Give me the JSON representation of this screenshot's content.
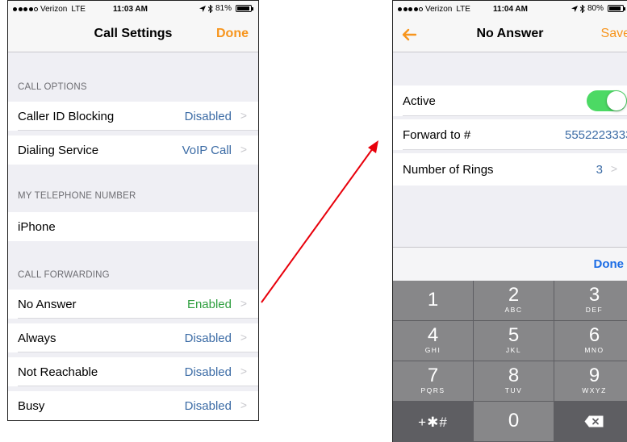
{
  "left_screen": {
    "status_bar": {
      "carrier": "Verizon",
      "network": "LTE",
      "time": "11:03 AM",
      "battery": "81%"
    },
    "nav": {
      "title": "Call Settings",
      "done_label": "Done"
    },
    "sections": [
      {
        "header": "CALL OPTIONS",
        "rows": [
          {
            "label": "Caller ID Blocking",
            "value": "Disabled"
          },
          {
            "label": "Dialing Service",
            "value": "VoIP Call"
          }
        ]
      },
      {
        "header": "MY TELEPHONE NUMBER",
        "rows": [
          {
            "label": "iPhone"
          }
        ]
      },
      {
        "header": "CALL FORWARDING",
        "rows": [
          {
            "label": "No Answer",
            "value": "Enabled"
          },
          {
            "label": "Always",
            "value": "Disabled"
          },
          {
            "label": "Not Reachable",
            "value": "Disabled"
          },
          {
            "label": "Busy",
            "value": "Disabled"
          }
        ]
      }
    ]
  },
  "right_screen": {
    "status_bar": {
      "carrier": "Verizon",
      "network": "LTE",
      "time": "11:04 AM",
      "battery": "80%"
    },
    "nav": {
      "title": "No Answer",
      "save_label": "Save"
    },
    "rows": {
      "active": {
        "label": "Active",
        "toggle_on": true
      },
      "forward_to": {
        "label": "Forward to #",
        "value": "5552223333"
      },
      "rings": {
        "label": "Number of Rings",
        "value": "3"
      }
    },
    "keyboard": {
      "done_label": "Done",
      "keys": [
        {
          "num": "1",
          "letters": ""
        },
        {
          "num": "2",
          "letters": "ABC"
        },
        {
          "num": "3",
          "letters": "DEF"
        },
        {
          "num": "4",
          "letters": "GHI"
        },
        {
          "num": "5",
          "letters": "JKL"
        },
        {
          "num": "6",
          "letters": "MNO"
        },
        {
          "num": "7",
          "letters": "PQRS"
        },
        {
          "num": "8",
          "letters": "TUV"
        },
        {
          "num": "9",
          "letters": "WXYZ"
        },
        {
          "symbols": "+✱#"
        },
        {
          "num": "0"
        },
        {
          "icon": "backspace-icon"
        }
      ]
    }
  },
  "colors": {
    "accent_orange": "#f7951d",
    "value_blue": "#3b6ba5",
    "enabled_green": "#2e9e3e",
    "toggle_green": "#4cd964",
    "keyboard_done_blue": "#1b6ce5",
    "arrow_red": "#e8000b"
  },
  "icons": [
    "chevron-right-icon",
    "back-arrow-icon",
    "backspace-icon",
    "location-arrow-icon",
    "bluetooth-icon",
    "battery-icon",
    "signal-dots-icon"
  ]
}
